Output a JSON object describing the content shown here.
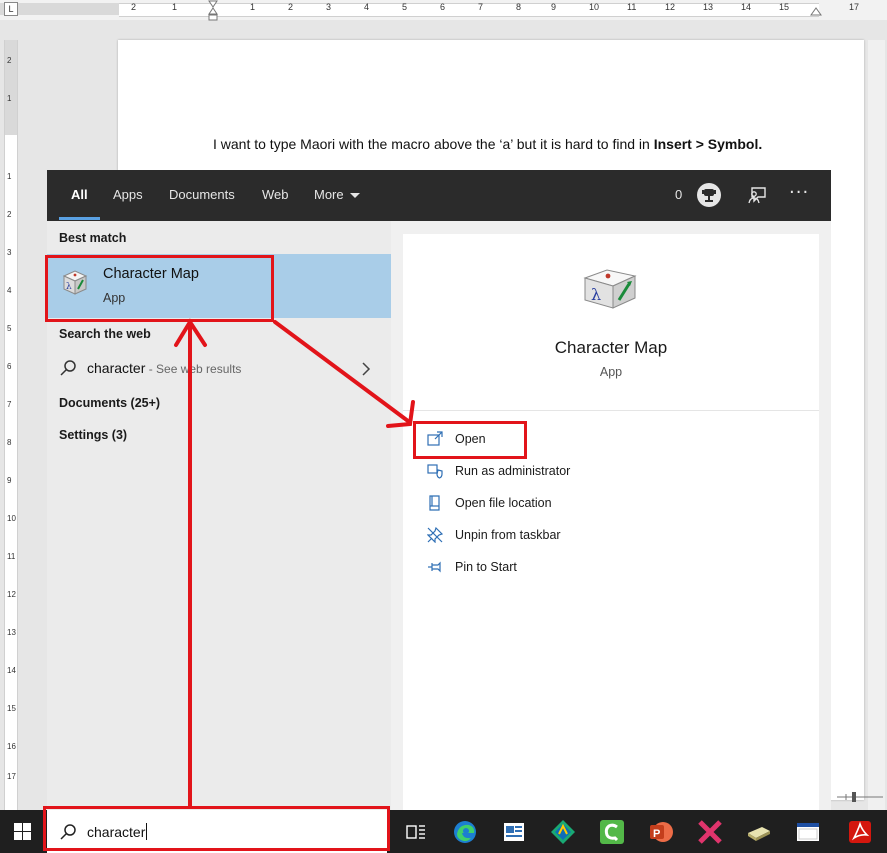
{
  "word": {
    "tab_selector": "L",
    "ruler_top_numbers": [
      "2",
      "1",
      "1",
      "2",
      "3",
      "4",
      "5",
      "6",
      "7",
      "8",
      "9",
      "10",
      "11",
      "12",
      "13",
      "14",
      "15",
      "17"
    ],
    "ruler_left_numbers": [
      "2",
      "1",
      "1",
      "2",
      "3",
      "4",
      "5",
      "6",
      "7",
      "8",
      "9",
      "10",
      "11",
      "12",
      "13",
      "14",
      "15",
      "16",
      "17"
    ],
    "sentence_start": "I want to type Maori with the macro above the ‘a’ but it is hard to find in ",
    "sentence_bold": "Insert > Symbol."
  },
  "search": {
    "tabs": {
      "all": "All",
      "apps": "Apps",
      "documents": "Documents",
      "web": "Web",
      "more": "More"
    },
    "rewards_count": "0",
    "options_label": "···",
    "best_match_heading": "Best match",
    "best_match": {
      "title": "Character Map",
      "subtitle": "App",
      "icon": "character-map-icon"
    },
    "search_web_heading": "Search the web",
    "web_result": {
      "query": "character",
      "hint": " - See web results"
    },
    "documents_heading": "Documents (25+)",
    "settings_heading": "Settings (3)",
    "preview": {
      "title": "Character Map",
      "subtitle": "App"
    },
    "actions": [
      {
        "label": "Open",
        "icon": "open-icon"
      },
      {
        "label": "Run as administrator",
        "icon": "shield-icon"
      },
      {
        "label": "Open file location",
        "icon": "file-location-icon"
      },
      {
        "label": "Unpin from taskbar",
        "icon": "unpin-icon"
      },
      {
        "label": "Pin to Start",
        "icon": "pin-icon"
      }
    ]
  },
  "taskbar": {
    "search_text": "character",
    "apps": [
      "task-view-icon",
      "edge-icon",
      "news-icon",
      "maps-icon",
      "camtasia-icon",
      "powerpoint-icon",
      "xmind-icon",
      "scanner-icon",
      "window-icon",
      "acrobat-icon"
    ]
  },
  "colors": {
    "highlight": "#a9cde8",
    "header_bg": "#2b2b2b",
    "annotation_red": "#e2141a",
    "accent": "#5aa1e3"
  }
}
